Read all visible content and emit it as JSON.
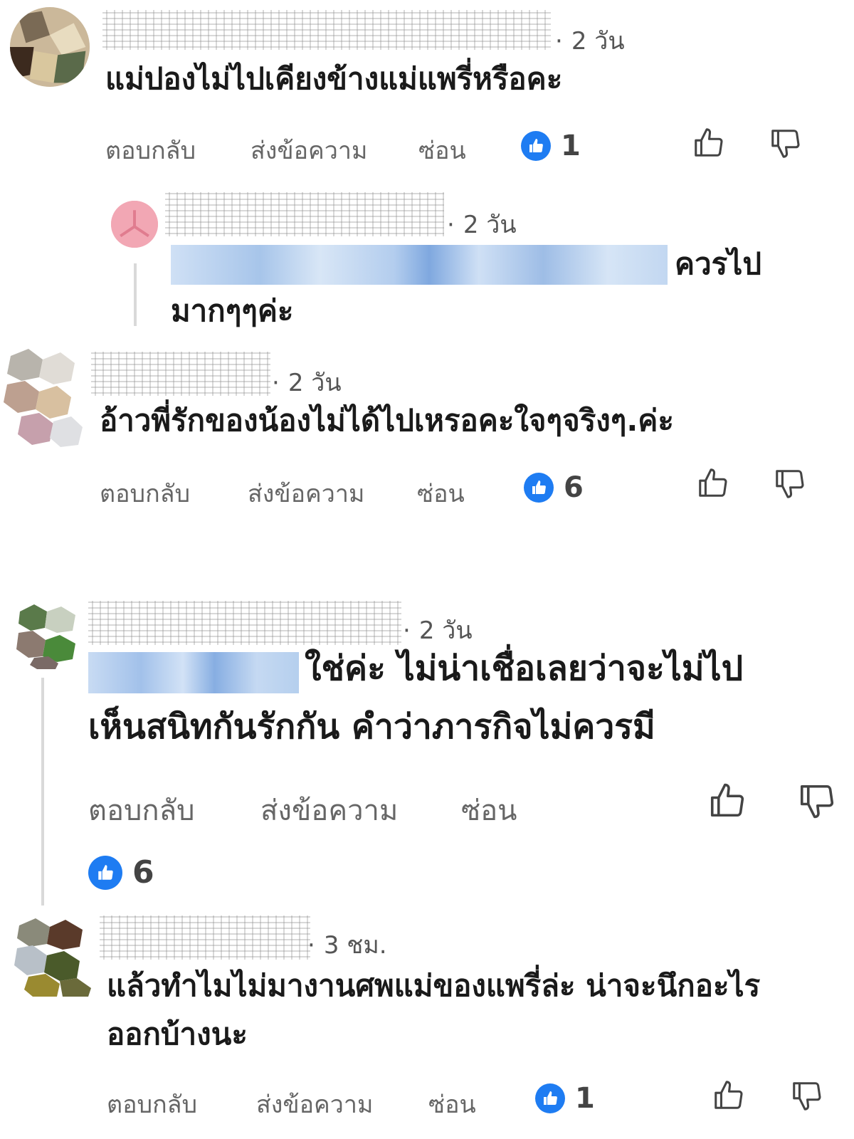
{
  "comments": [
    {
      "time": "2 วัน",
      "text": "แม่ปองไม่ไปเคียงข้างแม่แพรี่หรือคะ",
      "actions": {
        "reply": "ตอบกลับ",
        "message": "ส่งข้อความ",
        "hide": "ซ่อน"
      },
      "likes": "1"
    },
    {
      "time": "2 วัน",
      "text_line1_end": "ควรไป",
      "text_line2": "มากๆๆค่ะ"
    },
    {
      "time": "2 วัน",
      "text": "อ้าวพี่รักของน้องไม่ได้ไปเหรอคะใจๆจริงๆ.ค่ะ",
      "actions": {
        "reply": "ตอบกลับ",
        "message": "ส่งข้อความ",
        "hide": "ซ่อน"
      },
      "likes": "6"
    },
    {
      "time": "2 วัน",
      "text_line1_end": "ใช่ค่ะ ไม่น่าเชื่อเลยว่าจะไม่ไป",
      "text_line2": "เห็นสนิทกันรักกัน คำว่าภารกิจไม่ควรมี",
      "actions": {
        "reply": "ตอบกลับ",
        "message": "ส่งข้อความ",
        "hide": "ซ่อน"
      },
      "likes": "6"
    },
    {
      "time": "3 ชม.",
      "text_line1": "แล้วทำไมไม่มางานศพแม่ของแพรี่ล่ะ น่าจะนึกอะไร",
      "text_line2": "ออกบ้างนะ",
      "actions": {
        "reply": "ตอบกลับ",
        "message": "ส่งข้อความ",
        "hide": "ซ่อน"
      },
      "likes": "1"
    }
  ],
  "colors": {
    "like_blue": "#1e7cf2",
    "muted": "#666666"
  },
  "icons": [
    "thumbs-up-icon",
    "thumbs-down-icon",
    "like-reaction-icon"
  ]
}
